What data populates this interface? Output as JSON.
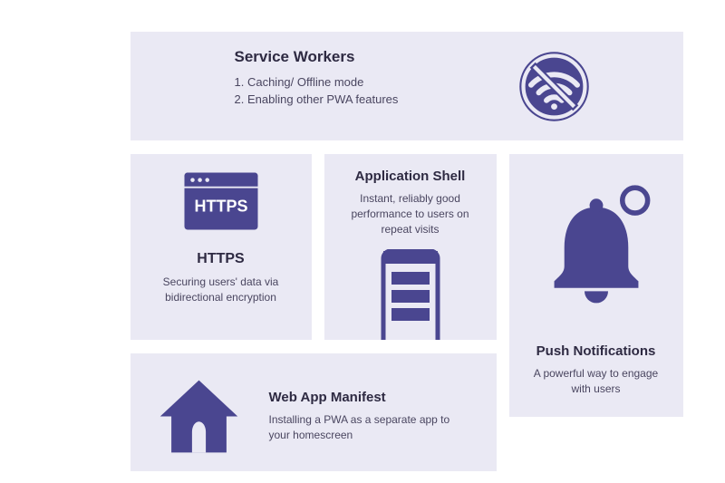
{
  "serviceWorkers": {
    "title": "Service Workers",
    "line1": "1. Caching/ Offline mode",
    "line2": "2. Enabling other PWA features"
  },
  "https": {
    "title": "HTTPS",
    "desc": "Securing users' data via bidirectional encryption",
    "iconLabel": "HTTPS"
  },
  "appShell": {
    "title": "Application Shell",
    "desc": "Instant, reliably good performance to users on repeat visits"
  },
  "push": {
    "title": "Push Notifications",
    "desc": "A powerful way to engage with users"
  },
  "manifest": {
    "title": "Web App Manifest",
    "desc": "Installing a PWA as a separate app to your homescreen"
  },
  "colors": {
    "primary": "#4a4690",
    "cardBg": "#eae9f4"
  }
}
